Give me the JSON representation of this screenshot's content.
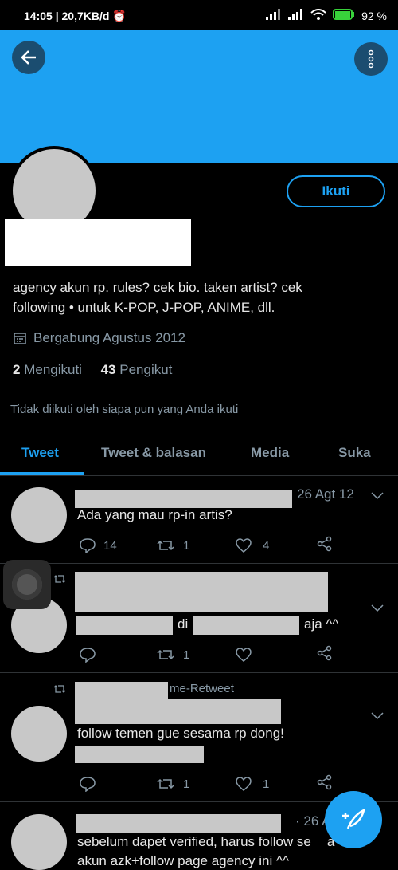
{
  "status": {
    "time": "14:05",
    "speed": "20,7KB/d",
    "battery": "92"
  },
  "profile": {
    "follow_label": "Ikuti",
    "bio_line1": "agency akun rp. rules? cek bio. taken artist? cek",
    "bio_line2": "following • untuk K-POP, J-POP, ANIME, dll.",
    "joined": "Bergabung Agustus 2012",
    "following_count": "2",
    "following_label": "Mengikuti",
    "followers_count": "43",
    "followers_label": "Pengikut",
    "not_followed": "Tidak diikuti oleh siapa pun yang Anda ikuti"
  },
  "tabs": [
    "Tweet",
    "Tweet & balasan",
    "Media",
    "Suka"
  ],
  "tweets": [
    {
      "date": "26 Agt 12",
      "text": "Ada yang mau rp-in artis?",
      "replies": "14",
      "retweets": "1",
      "likes": "4"
    },
    {
      "mid_word": "di",
      "end_word": "aja ^^",
      "retweets": "1"
    },
    {
      "retweet_suffix": "me-Retweet",
      "text": "follow temen gue sesama rp dong!",
      "retweets": "1",
      "likes": "1"
    },
    {
      "date": "· 26 A",
      "line1": "sebelum dapet verified, harus follow se",
      "line1_tail": "a",
      "line2": "akun azk+follow page agency ini ^^"
    }
  ]
}
